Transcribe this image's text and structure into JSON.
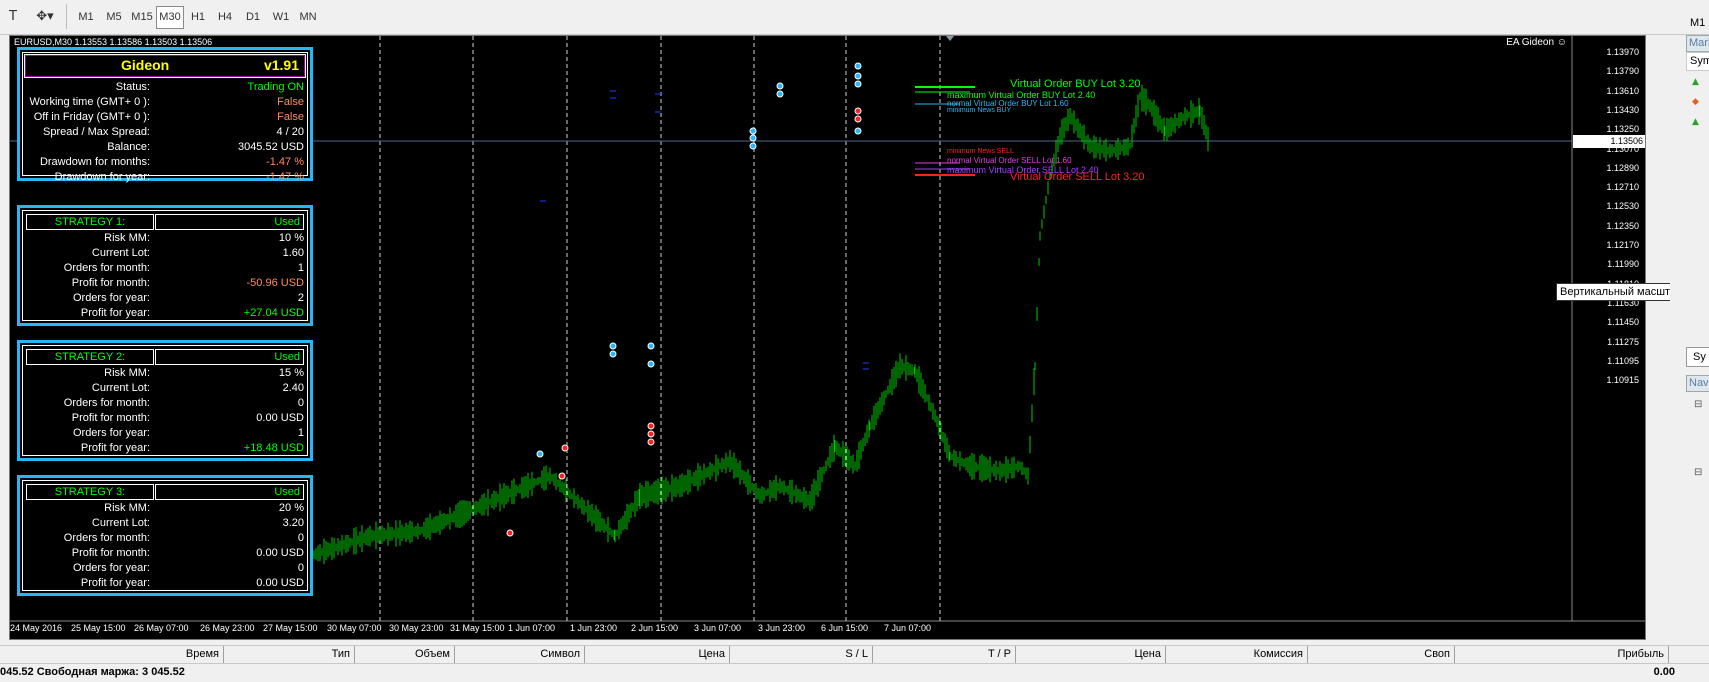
{
  "toolbar": {
    "timeframes": [
      "M1",
      "M5",
      "M15",
      "M30",
      "H1",
      "H4",
      "D1",
      "W1",
      "MN"
    ],
    "active_timeframe": "M30"
  },
  "chart": {
    "header": "EURUSD,M30  1.13553 1.13586 1.13503 1.13506",
    "ea_label": "EA Gideon ☺",
    "current_price": "1.13506",
    "price_levels": [
      "1.13970",
      "1.13790",
      "1.13610",
      "1.13430",
      "1.13250",
      "1.13070",
      "1.12890",
      "1.12710",
      "1.12530",
      "1.12350",
      "1.12170",
      "1.11990",
      "1.11810",
      "1.11630",
      "1.11450",
      "1.11275",
      "1.11095",
      "1.10915"
    ],
    "dates": [
      "24 May 2016",
      "25 May 15:00",
      "26 May 07:00",
      "26 May 23:00",
      "27 May 15:00",
      "30 May 07:00",
      "30 May 23:00",
      "31 May 15:00",
      "1 Jun 07:00",
      "1 Jun 23:00",
      "2 Jun 15:00",
      "3 Jun 07:00",
      "3 Jun 23:00",
      "6 Jun 15:00",
      "7 Jun 07:00"
    ],
    "colors": {
      "bull": "#00c800",
      "buy": "#00ff00",
      "sell": "#ff2020",
      "panel_border": "#29b6f6",
      "title": "#ffff00",
      "warn": "#ff8c5a"
    },
    "order_labels": {
      "virtual_buy": "Virtual Order BUY Lot 3.20",
      "maximum_buy": "maximum Virtual Order BUY Lot 2.40",
      "normal_buy": "normal Virtual Order BUY Lot 1.60",
      "minimum_buy": "minimum News BUY",
      "minimum_sell": "minimum News SELL",
      "normal_sell": "normal Virtual Order SELL Lot 1.60",
      "maximum_sell": "maximum Virtual Order SELL Lot 2.40",
      "virtual_sell": "Virtual Order SELL Lot 3.20"
    }
  },
  "ea": {
    "title": "Gideon",
    "version": "v1.91",
    "status_rows": [
      {
        "label": "Status:",
        "value": "Trading ON",
        "color": "#00ff00"
      },
      {
        "label": "Working time (GMT+ 0 ):",
        "value": "False",
        "color": "#ff8c5a"
      },
      {
        "label": "Off in Friday (GMT+ 0 ):",
        "value": "False",
        "color": "#ff8c5a"
      },
      {
        "label": "Spread / Max Spread:",
        "value": "4 / 20",
        "color": "#ffffff"
      },
      {
        "label": "Balance:",
        "value": "3045.52 USD",
        "color": "#ffffff"
      },
      {
        "label": "Drawdown for months:",
        "value": "-1.47 %",
        "color": "#ff8c5a"
      },
      {
        "label": "Drawdown for year:",
        "value": "-1.47 %",
        "color": "#ff8c5a"
      }
    ],
    "strategies": [
      {
        "name": "STRATEGY 1:",
        "state": "Used",
        "rows": [
          {
            "label": "Risk MM:",
            "value": "10 %",
            "color": "#ffffff"
          },
          {
            "label": "Current Lot:",
            "value": "1.60",
            "color": "#ffffff"
          },
          {
            "label": "Orders for month:",
            "value": "1",
            "color": "#ffffff"
          },
          {
            "label": "Profit for month:",
            "value": "-50.96 USD",
            "color": "#ff8c5a"
          },
          {
            "label": "Orders for year:",
            "value": "2",
            "color": "#ffffff"
          },
          {
            "label": "Profit for year:",
            "value": "+27.04 USD",
            "color": "#00ff00"
          }
        ]
      },
      {
        "name": "STRATEGY 2:",
        "state": "Used",
        "rows": [
          {
            "label": "Risk MM:",
            "value": "15 %",
            "color": "#ffffff"
          },
          {
            "label": "Current Lot:",
            "value": "2.40",
            "color": "#ffffff"
          },
          {
            "label": "Orders for month:",
            "value": "0",
            "color": "#ffffff"
          },
          {
            "label": "Profit for month:",
            "value": "0.00 USD",
            "color": "#ffffff"
          },
          {
            "label": "Orders for year:",
            "value": "1",
            "color": "#ffffff"
          },
          {
            "label": "Profit for year:",
            "value": "+18.48 USD",
            "color": "#00ff00"
          }
        ]
      },
      {
        "name": "STRATEGY 3:",
        "state": "Used",
        "rows": [
          {
            "label": "Risk MM:",
            "value": "20 %",
            "color": "#ffffff"
          },
          {
            "label": "Current Lot:",
            "value": "3.20",
            "color": "#ffffff"
          },
          {
            "label": "Orders for month:",
            "value": "0",
            "color": "#ffffff"
          },
          {
            "label": "Profit for month:",
            "value": "0.00 USD",
            "color": "#ffffff"
          },
          {
            "label": "Orders for year:",
            "value": "0",
            "color": "#ffffff"
          },
          {
            "label": "Profit for year:",
            "value": "0.00 USD",
            "color": "#ffffff"
          }
        ]
      }
    ]
  },
  "tooltip": "Вертикальный масштаб",
  "right_panel": {
    "tab_top": "M1",
    "market": "Mark",
    "symbol": "Sym",
    "symbol2": "Sy",
    "navigator": "Navi"
  },
  "terminal": {
    "columns": [
      "Время",
      "Тип",
      "Объем",
      "Символ",
      "Цена",
      "S / L",
      "T / P",
      "Цена",
      "Комиссия",
      "Своп",
      "Прибыль"
    ],
    "status_left": "045.52  Свободная маржа: 3 045.52",
    "status_right": "0.00"
  }
}
